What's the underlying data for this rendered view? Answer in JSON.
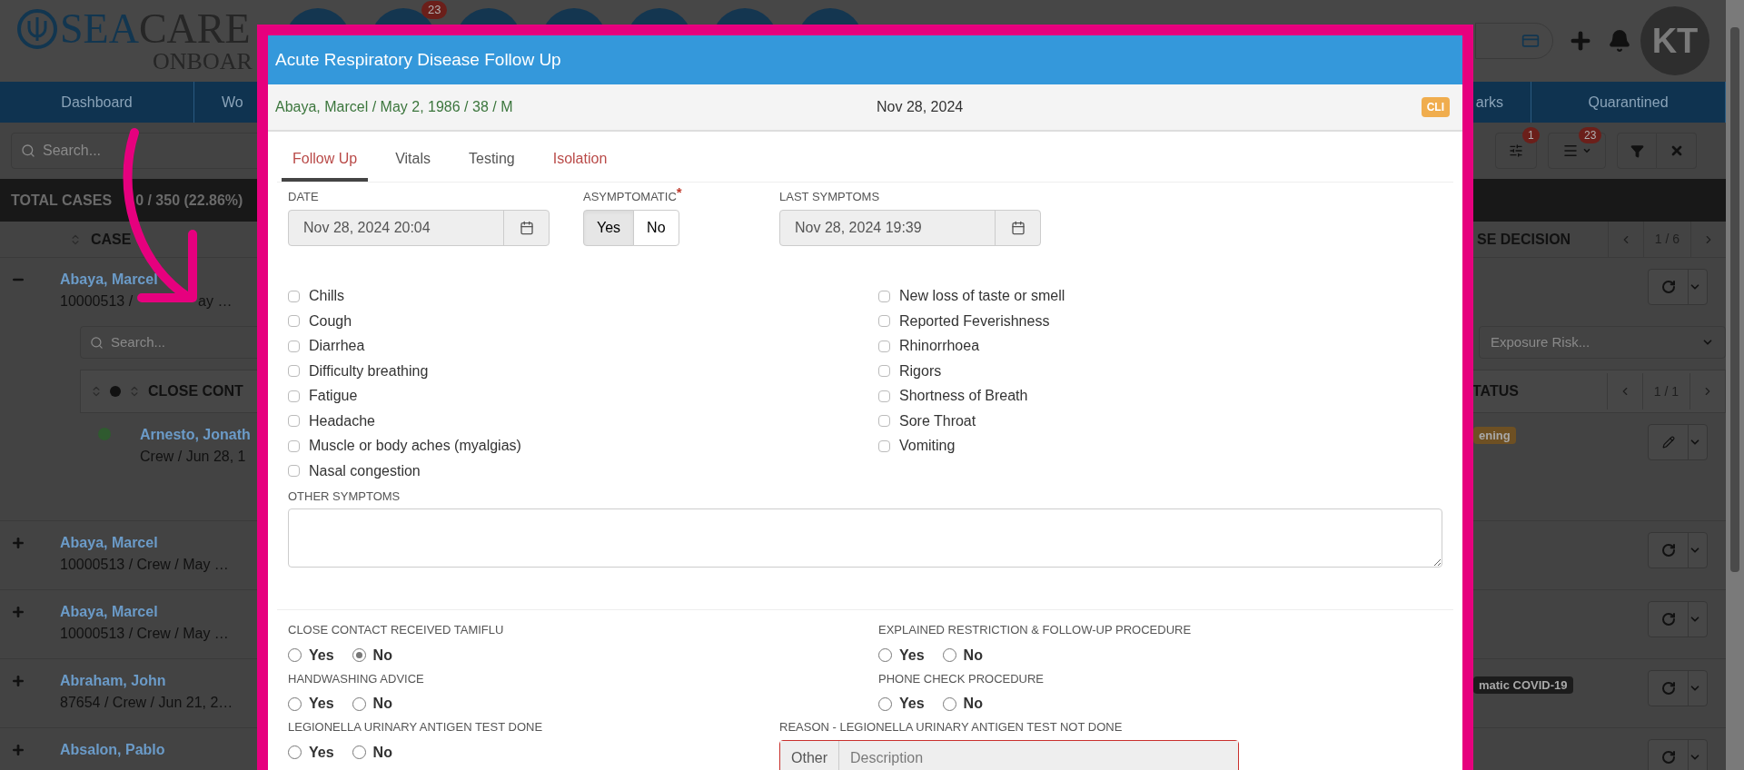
{
  "app": {
    "logo_primary": "SEA",
    "logo_secondary": "CARE",
    "logo_sub": "ONBOAR",
    "header_badge": "23",
    "avatar": "KT",
    "nav": [
      {
        "label": "Dashboard"
      },
      {
        "label": "Wo"
      },
      {
        "label": "arks"
      },
      {
        "label": "Quarantined"
      }
    ],
    "search_placeholder": "Search...",
    "toolbar_badges": [
      "1",
      "23"
    ],
    "total": [
      "TOTAL CASES",
      "0 / 350 (22.86%)"
    ],
    "columns": [
      "CASE",
      "SE DECISION"
    ],
    "pager": "1 / 6",
    "cases": [
      {
        "name": "Abaya, Marcel",
        "detail": [
          "10000513 /",
          "ay …"
        ],
        "expanded": true,
        "contacts": {
          "search_placeholder": "Search...",
          "filter_placeholder": "Exposure Risk...",
          "columns": [
            "CLOSE CONT",
            "TATUS"
          ],
          "pager": "1 / 1",
          "rows": [
            {
              "name": "Arnesto, Jonath",
              "detail": "Crew / Jun 28, 1",
              "tag": {
                "text": "ening",
                "color": "#6e5023"
              },
              "color": "#2f5a2f"
            }
          ]
        }
      },
      {
        "name": "Abaya, Marcel",
        "detail": [
          "10000513 / Crew / May …"
        ],
        "expanded": false
      },
      {
        "name": "Abaya, Marcel",
        "detail": [
          "10000513 / Crew / May …"
        ],
        "expanded": false
      },
      {
        "name": "Abraham, John",
        "detail": [
          "87654 / Crew / Jun 21, 2…"
        ],
        "expanded": false,
        "tag": {
          "text": "matic COVID-19",
          "color": "#1c1c1c"
        }
      },
      {
        "name": "Absalon, Pablo",
        "expanded": false
      }
    ]
  },
  "modal": {
    "title": "Acute Respiratory Disease Follow Up",
    "patient": "Abaya, Marcel / May 2, 1986 / 38 / M",
    "date": "Nov 28, 2024",
    "badge": "CLI",
    "tabs": [
      {
        "label": "Follow Up",
        "selected": true,
        "flagged": true
      },
      {
        "label": "Vitals",
        "selected": false,
        "flagged": false
      },
      {
        "label": "Testing",
        "selected": false,
        "flagged": false
      },
      {
        "label": "Isolation",
        "selected": false,
        "flagged": true
      }
    ],
    "date_field": {
      "label": "DATE",
      "value": "Nov 28, 2024 20:04"
    },
    "asymptomatic": {
      "label": "ASYMPTOMATIC",
      "required_mark": "*",
      "options": [
        {
          "label": "Yes",
          "selected": true
        },
        {
          "label": "No",
          "selected": false
        }
      ]
    },
    "last_symptoms": {
      "label": "LAST SYMPTOMS",
      "value": "Nov 28, 2024 19:39"
    },
    "symptoms": [
      [
        {
          "label": "Chills",
          "checked": false
        },
        {
          "label": "Cough",
          "checked": false
        },
        {
          "label": "Diarrhea",
          "checked": false
        },
        {
          "label": "Difficulty breathing",
          "checked": false
        },
        {
          "label": "Fatigue",
          "checked": false
        },
        {
          "label": "Headache",
          "checked": false
        },
        {
          "label": "Muscle or body aches (myalgias)",
          "checked": false
        },
        {
          "label": "Nasal congestion",
          "checked": false
        }
      ],
      [
        {
          "label": "New loss of taste or smell",
          "checked": false
        },
        {
          "label": "Reported Feverishness",
          "checked": false
        },
        {
          "label": "Rhinorrhoea",
          "checked": false
        },
        {
          "label": "Rigors",
          "checked": false
        },
        {
          "label": "Shortness of Breath",
          "checked": false
        },
        {
          "label": "Sore Throat",
          "checked": false
        },
        {
          "label": "Vomiting",
          "checked": false
        }
      ]
    ],
    "other_symptoms": {
      "label": "OTHER SYMPTOMS"
    },
    "questions": [
      {
        "label": "CLOSE CONTACT RECEIVED TAMIFLU",
        "options": [
          {
            "label": "Yes",
            "selected": false
          },
          {
            "label": "No",
            "selected": true
          }
        ]
      },
      {
        "label": "EXPLAINED RESTRICTION & FOLLOW-UP PROCEDURE",
        "options": [
          {
            "label": "Yes",
            "selected": false
          },
          {
            "label": "No",
            "selected": false
          }
        ]
      },
      {
        "label": "HANDWASHING ADVICE",
        "options": [
          {
            "label": "Yes",
            "selected": false
          },
          {
            "label": "No",
            "selected": false
          }
        ]
      },
      {
        "label": "PHONE CHECK PROCEDURE",
        "options": [
          {
            "label": "Yes",
            "selected": false
          },
          {
            "label": "No",
            "selected": false
          }
        ]
      },
      {
        "label": "LEGIONELLA URINARY ANTIGEN TEST DONE",
        "options": [
          {
            "label": "Yes",
            "selected": false
          },
          {
            "label": "No",
            "selected": false
          }
        ]
      }
    ],
    "reason": {
      "label": "REASON - LEGIONELLA URINARY ANTIGEN TEST NOT DONE",
      "addon": "Other",
      "placeholder": "Description"
    }
  }
}
